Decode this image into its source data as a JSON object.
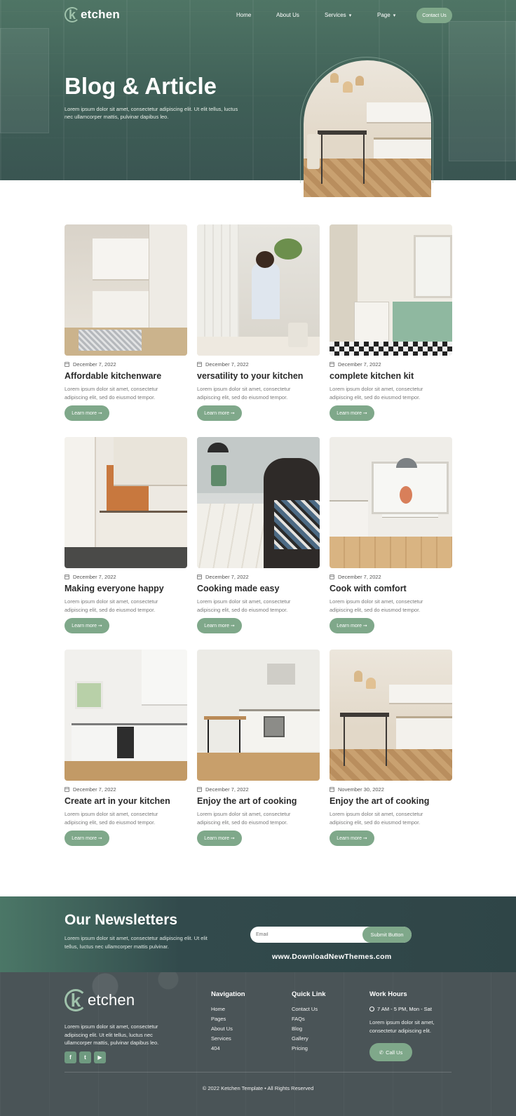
{
  "brand": {
    "logo_letter": "k",
    "logo_text": "etchen"
  },
  "nav": {
    "items": [
      {
        "label": "Home"
      },
      {
        "label": "About Us"
      },
      {
        "label": "Services"
      },
      {
        "label": "Page"
      }
    ],
    "contact_label": "Contact Us"
  },
  "hero": {
    "title": "Blog & Article",
    "description": "Lorem ipsum dolor sit amet, consectetur adipiscing elit. Ut elit tellus, luctus nec ullamcorper mattis, pulvinar dapibus leo."
  },
  "posts": [
    {
      "date": "December 7, 2022",
      "title": "Affordable kitchenware",
      "excerpt": "Lorem ipsum dolor sit amet, consectetur adipiscing elit, sed do eiusmod tempor.",
      "cta": "Learn more ➞"
    },
    {
      "date": "December 7, 2022",
      "title": "versatility to your kitchen",
      "excerpt": "Lorem ipsum dolor sit amet, consectetur adipiscing elit, sed do eiusmod tempor.",
      "cta": "Learn more ➞"
    },
    {
      "date": "December 7, 2022",
      "title": "complete kitchen kit",
      "excerpt": "Lorem ipsum dolor sit amet, consectetur adipiscing elit, sed do eiusmod tempor.",
      "cta": "Learn more ➞"
    },
    {
      "date": "December 7, 2022",
      "title": "Making everyone happy",
      "excerpt": "Lorem ipsum dolor sit amet, consectetur adipiscing elit, sed do eiusmod tempor.",
      "cta": "Learn more ➞"
    },
    {
      "date": "December 7, 2022",
      "title": "Cooking made easy",
      "excerpt": "Lorem ipsum dolor sit amet, consectetur adipiscing elit, sed do eiusmod tempor.",
      "cta": "Learn more ➞"
    },
    {
      "date": "December 7, 2022",
      "title": "Cook with comfort",
      "excerpt": "Lorem ipsum dolor sit amet, consectetur adipiscing elit, sed do eiusmod tempor.",
      "cta": "Learn more ➞"
    },
    {
      "date": "December 7, 2022",
      "title": "Create art in your kitchen",
      "excerpt": "Lorem ipsum dolor sit amet, consectetur adipiscing elit, sed do eiusmod tempor.",
      "cta": "Learn more ➞"
    },
    {
      "date": "December 7, 2022",
      "title": "Enjoy the art of cooking",
      "excerpt": "Lorem ipsum dolor sit amet, consectetur adipiscing elit, sed do eiusmod tempor.",
      "cta": "Learn more ➞"
    },
    {
      "date": "November 30, 2022",
      "title": "Enjoy the art of cooking",
      "excerpt": "Lorem ipsum dolor sit amet, consectetur adipiscing elit, sed do eiusmod tempor.",
      "cta": "Learn more ➞"
    }
  ],
  "newsletter": {
    "title": "Our Newsletters",
    "description": "Lorem ipsum dolor sit amet, consectetur adipiscing elit. Ut elit tellus, luctus nec ullamcorper mattis pulvinar.",
    "email_placeholder": "Email",
    "submit_label": "Submit Button",
    "watermark": "www.DownloadNewThemes.com"
  },
  "footer": {
    "description": "Lorem ipsum dolor sit amet, consectetur adipiscing elit. Ut elit tellus, luctus nec ullamcorper mattis, pulvinar dapibus leo.",
    "socials": [
      "facebook-icon",
      "twitter-icon",
      "youtube-icon"
    ],
    "navigation": {
      "title": "Navigation",
      "links": [
        "Home",
        "Pages",
        "About Us",
        "Services",
        "404"
      ]
    },
    "quick_link": {
      "title": "Quick Link",
      "links": [
        "Contact Us",
        "FAQs",
        "Blog",
        "Gallery",
        "Pricing"
      ]
    },
    "work_hours": {
      "title": "Work Hours",
      "hours": "7 AM - 5 PM, Mon - Sat",
      "description": "Lorem ipsum dolor sit amet, consectetur adipiscing elit.",
      "call_label": "Call Us"
    },
    "copyright": "© 2022 Ketchen Template • All Rights Reserved"
  },
  "colors": {
    "accent": "#7fa88a",
    "hero_bg": "#45685d",
    "footer_bg": "#4a5457",
    "newsletter_bg": "#324a4c"
  }
}
